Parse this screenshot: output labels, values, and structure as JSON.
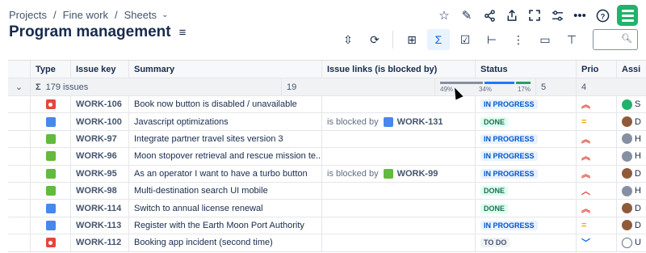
{
  "breadcrumb": {
    "items": [
      "Projects",
      "Fine work",
      "Sheets"
    ]
  },
  "title": "Program management",
  "search": {
    "placeholder": ""
  },
  "columns": {
    "type": "Type",
    "key": "Issue key",
    "summary": "Summary",
    "links": "Issue links (is blocked by)",
    "status": "Status",
    "prio": "Prio",
    "assignee": "Assi"
  },
  "group": {
    "sigma": "Σ",
    "count": "179 issues",
    "links_count": "19",
    "prio_count": "5",
    "assignee_count": "4",
    "progress": {
      "todo": "49%",
      "inprogress": "34%",
      "done": "17%",
      "todo_frac": 0.49,
      "inprogress_frac": 0.34,
      "done_frac": 0.17
    }
  },
  "colors": {
    "todo": "#8590a2",
    "inprogress": "#1d7afc",
    "done": "#22a06b"
  },
  "rows": [
    {
      "type": "bug",
      "key": "WORK-106",
      "summary": "Book now button is disabled / unavailable",
      "blocked_label": "",
      "blocked_key": "",
      "blocked_type": "",
      "status": "IN PROGRESS",
      "status_class": "inprogress",
      "prio_glyph": "︽",
      "prio_class": "highest",
      "assignee": "S",
      "avatar": "green"
    },
    {
      "type": "task",
      "key": "WORK-100",
      "summary": "Javascript optimizations",
      "blocked_label": "is blocked by",
      "blocked_key": "WORK-131",
      "blocked_type": "task",
      "status": "DONE",
      "status_class": "done",
      "prio_glyph": "=",
      "prio_class": "medium",
      "assignee": "D",
      "avatar": "brown"
    },
    {
      "type": "story",
      "key": "WORK-97",
      "summary": "Integrate partner travel sites version 3",
      "blocked_label": "",
      "blocked_key": "",
      "blocked_type": "",
      "status": "IN PROGRESS",
      "status_class": "inprogress",
      "prio_glyph": "︽",
      "prio_class": "highest",
      "assignee": "H",
      "avatar": "gray"
    },
    {
      "type": "story",
      "key": "WORK-96",
      "summary": "Moon stopover retrieval and rescue mission te...",
      "blocked_label": "",
      "blocked_key": "",
      "blocked_type": "",
      "status": "IN PROGRESS",
      "status_class": "inprogress",
      "prio_glyph": "︽",
      "prio_class": "highest",
      "assignee": "H",
      "avatar": "gray"
    },
    {
      "type": "story",
      "key": "WORK-95",
      "summary": "As an operator I want to have a turbo button",
      "blocked_label": "is blocked by",
      "blocked_key": "WORK-99",
      "blocked_type": "story",
      "status": "IN PROGRESS",
      "status_class": "inprogress",
      "prio_glyph": "︽",
      "prio_class": "highest",
      "assignee": "D",
      "avatar": "brown"
    },
    {
      "type": "story",
      "key": "WORK-98",
      "summary": "Multi-destination search UI mobile",
      "blocked_label": "",
      "blocked_key": "",
      "blocked_type": "",
      "status": "DONE",
      "status_class": "done",
      "prio_glyph": "︿",
      "prio_class": "high",
      "assignee": "H",
      "avatar": "gray"
    },
    {
      "type": "task",
      "key": "WORK-114",
      "summary": "Switch to annual license renewal",
      "blocked_label": "",
      "blocked_key": "",
      "blocked_type": "",
      "status": "DONE",
      "status_class": "done",
      "prio_glyph": "︽",
      "prio_class": "highest",
      "assignee": "D",
      "avatar": "brown"
    },
    {
      "type": "task",
      "key": "WORK-113",
      "summary": "Register with the Earth Moon Port Authority",
      "blocked_label": "",
      "blocked_key": "",
      "blocked_type": "",
      "status": "IN PROGRESS",
      "status_class": "inprogress",
      "prio_glyph": "=",
      "prio_class": "medium",
      "assignee": "D",
      "avatar": "brown"
    },
    {
      "type": "bug",
      "key": "WORK-112",
      "summary": "Booking app incident (second time)",
      "blocked_label": "",
      "blocked_key": "",
      "blocked_type": "",
      "status": "TO DO",
      "status_class": "todo",
      "prio_glyph": "﹀",
      "prio_class": "low",
      "assignee": "U",
      "avatar": "outline"
    }
  ]
}
